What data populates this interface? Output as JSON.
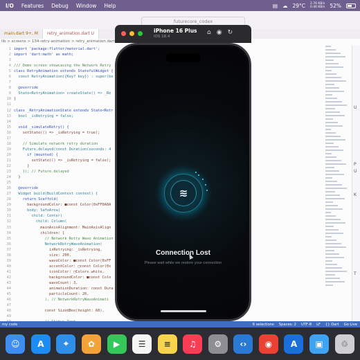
{
  "menubar": {
    "items": [
      "I/O",
      "Features",
      "Debug",
      "Window",
      "Help"
    ],
    "temperature": "29°C",
    "net_up": "2.76 KB/s",
    "net_down": "0.46 KB/s",
    "battery": "52%"
  },
  "ide": {
    "search_placeholder": "futurecore_codex",
    "tabs": [
      {
        "label": "main.dart 9+, M"
      },
      {
        "label": "retry_animation.dart U"
      }
    ],
    "breadcrumb": "lib > screens > 134-retry-animation > retry_animation.dart >",
    "code_lines": [
      {
        "n": "1",
        "text": "import 'package:flutter/material.dart';",
        "cls": "src kw"
      },
      {
        "n": "2",
        "text": "import 'dart:math' as math;",
        "cls": "src kw"
      },
      {
        "n": "3",
        "text": "",
        "cls": "src"
      },
      {
        "n": "4",
        "text": "/// Demo screen showcasing the Network Retry",
        "cls": "src cm"
      },
      {
        "n": "5",
        "text": "class RetryAnimation extends StatefulWidget {",
        "cls": "src kw"
      },
      {
        "n": "6",
        "text": "  const RetryAnimation({Key? key}) : super(ke",
        "cls": "src tp"
      },
      {
        "n": "7",
        "text": "",
        "cls": "src"
      },
      {
        "n": "8",
        "text": "  @override",
        "cls": "src kw"
      },
      {
        "n": "9",
        "text": "  State<RetryAnimation> createState() => _Re",
        "cls": "src tp"
      },
      {
        "n": "10",
        "text": "}",
        "cls": "src"
      },
      {
        "n": "11",
        "text": "",
        "cls": "src"
      },
      {
        "n": "12",
        "text": "class _RetryAnimationState extends State<Retr",
        "cls": "src kw"
      },
      {
        "n": "13",
        "text": "  bool _isRetrying = false;",
        "cls": "src tp"
      },
      {
        "n": "14",
        "text": "",
        "cls": "src"
      },
      {
        "n": "15",
        "text": "  void _simulateRetry() {",
        "cls": "src kw"
      },
      {
        "n": "16",
        "text": "    setState(() => _isRetrying = true);",
        "cls": "src"
      },
      {
        "n": "17",
        "text": "",
        "cls": "src"
      },
      {
        "n": "18",
        "text": "    // Simulate network retry duration",
        "cls": "src cm"
      },
      {
        "n": "19",
        "text": "    Future.delayed(const Duration(seconds: 4",
        "cls": "src tp"
      },
      {
        "n": "20",
        "text": "      if (mounted) {",
        "cls": "src kw"
      },
      {
        "n": "21",
        "text": "        setState(() => _isRetrying = false);",
        "cls": "src"
      },
      {
        "n": "22",
        "text": "      }",
        "cls": "src"
      },
      {
        "n": "23",
        "text": "    }); // Future.delayed",
        "cls": "src cm"
      },
      {
        "n": "24",
        "text": "  }",
        "cls": "src"
      },
      {
        "n": "25",
        "text": "",
        "cls": "src"
      },
      {
        "n": "26",
        "text": "  @override",
        "cls": "src kw"
      },
      {
        "n": "27",
        "text": "  Widget build(BuildContext context) {",
        "cls": "src tp"
      },
      {
        "n": "28",
        "text": "    return Scaffold(",
        "cls": "src kw"
      },
      {
        "n": "29",
        "text": "      backgroundColor: ■const Color(0xFF0A0A",
        "cls": "src"
      },
      {
        "n": "30",
        "text": "      body: SafeArea(",
        "cls": "src tp"
      },
      {
        "n": "31",
        "text": "        child: Center(",
        "cls": "src tp"
      },
      {
        "n": "32",
        "text": "          child: Column(",
        "cls": "src tp"
      },
      {
        "n": "33",
        "text": "            mainAxisAlignment: MainAxisAlign",
        "cls": "src"
      },
      {
        "n": "34",
        "text": "            children: [",
        "cls": "src"
      },
      {
        "n": "35",
        "text": "              // Network Retry Wave Animation",
        "cls": "src cm"
      },
      {
        "n": "36",
        "text": "              NetworkRetryWaveAnimation(",
        "cls": "src tp"
      },
      {
        "n": "37",
        "text": "                isRetrying: _isRetrying,",
        "cls": "src"
      },
      {
        "n": "38",
        "text": "                size: 200,",
        "cls": "src"
      },
      {
        "n": "39",
        "text": "                waveColor: ■const Color(0xFF",
        "cls": "src"
      },
      {
        "n": "40",
        "text": "                accentColor: □const Color(0x",
        "cls": "src"
      },
      {
        "n": "41",
        "text": "                iconColor: □Colors.white,",
        "cls": "src"
      },
      {
        "n": "42",
        "text": "                backgroundColor: ■const Colo",
        "cls": "src"
      },
      {
        "n": "43",
        "text": "                waveCount: 3,",
        "cls": "src"
      },
      {
        "n": "44",
        "text": "                animationDuration: const Dura",
        "cls": "src"
      },
      {
        "n": "45",
        "text": "                particleCount: 20,",
        "cls": "src"
      },
      {
        "n": "46",
        "text": "              ), // NetworkRetryWaveAnimati",
        "cls": "src cm"
      },
      {
        "n": "47",
        "text": "",
        "cls": "src"
      },
      {
        "n": "48",
        "text": "              const SizedBox(height: 60),",
        "cls": "src"
      },
      {
        "n": "49",
        "text": "",
        "cls": "src"
      },
      {
        "n": "50",
        "text": "              // Status Text",
        "cls": "src cm"
      }
    ],
    "status_left": "my code",
    "status_right": [
      "6 selections",
      "Spaces: 2",
      "UTF-8",
      "LF",
      "{} Dart",
      "Go Live"
    ]
  },
  "simulator": {
    "device": "iPhone 16 Plus",
    "os": "iOS 18.4",
    "title": "Connection Lost",
    "subtitle": "Please wait while we restore your connection"
  },
  "dock": {
    "apps": [
      {
        "name": "Finder",
        "glyph": "☺",
        "color": "#3d8ef0"
      },
      {
        "name": "App Store",
        "glyph": "A",
        "color": "#1d8cf5"
      },
      {
        "name": "Safari",
        "glyph": "⌖",
        "color": "#2f8fe8"
      },
      {
        "name": "Photos",
        "glyph": "✿",
        "color": "#f3a23a"
      },
      {
        "name": "FaceTime",
        "glyph": "▶",
        "color": "#34c759"
      },
      {
        "name": "Reminders",
        "glyph": "☰",
        "color": "#f5f5f5"
      },
      {
        "name": "Notes",
        "glyph": "≡",
        "color": "#f7d44c"
      },
      {
        "name": "Music",
        "glyph": "♫",
        "color": "#fa3d55"
      },
      {
        "name": "System Settings",
        "glyph": "⚙",
        "color": "#8e8e93"
      },
      {
        "name": "VS Code",
        "glyph": "‹›",
        "color": "#2a7ad5"
      },
      {
        "name": "Chrome",
        "glyph": "◉",
        "color": "#e94235"
      },
      {
        "name": "Xcode",
        "glyph": "A",
        "color": "#1b6fdc"
      },
      {
        "name": "Simulator",
        "glyph": "▣",
        "color": "#3ea3f2"
      },
      {
        "name": "Trash",
        "glyph": "♲",
        "color": "#cfcfd3"
      }
    ]
  }
}
